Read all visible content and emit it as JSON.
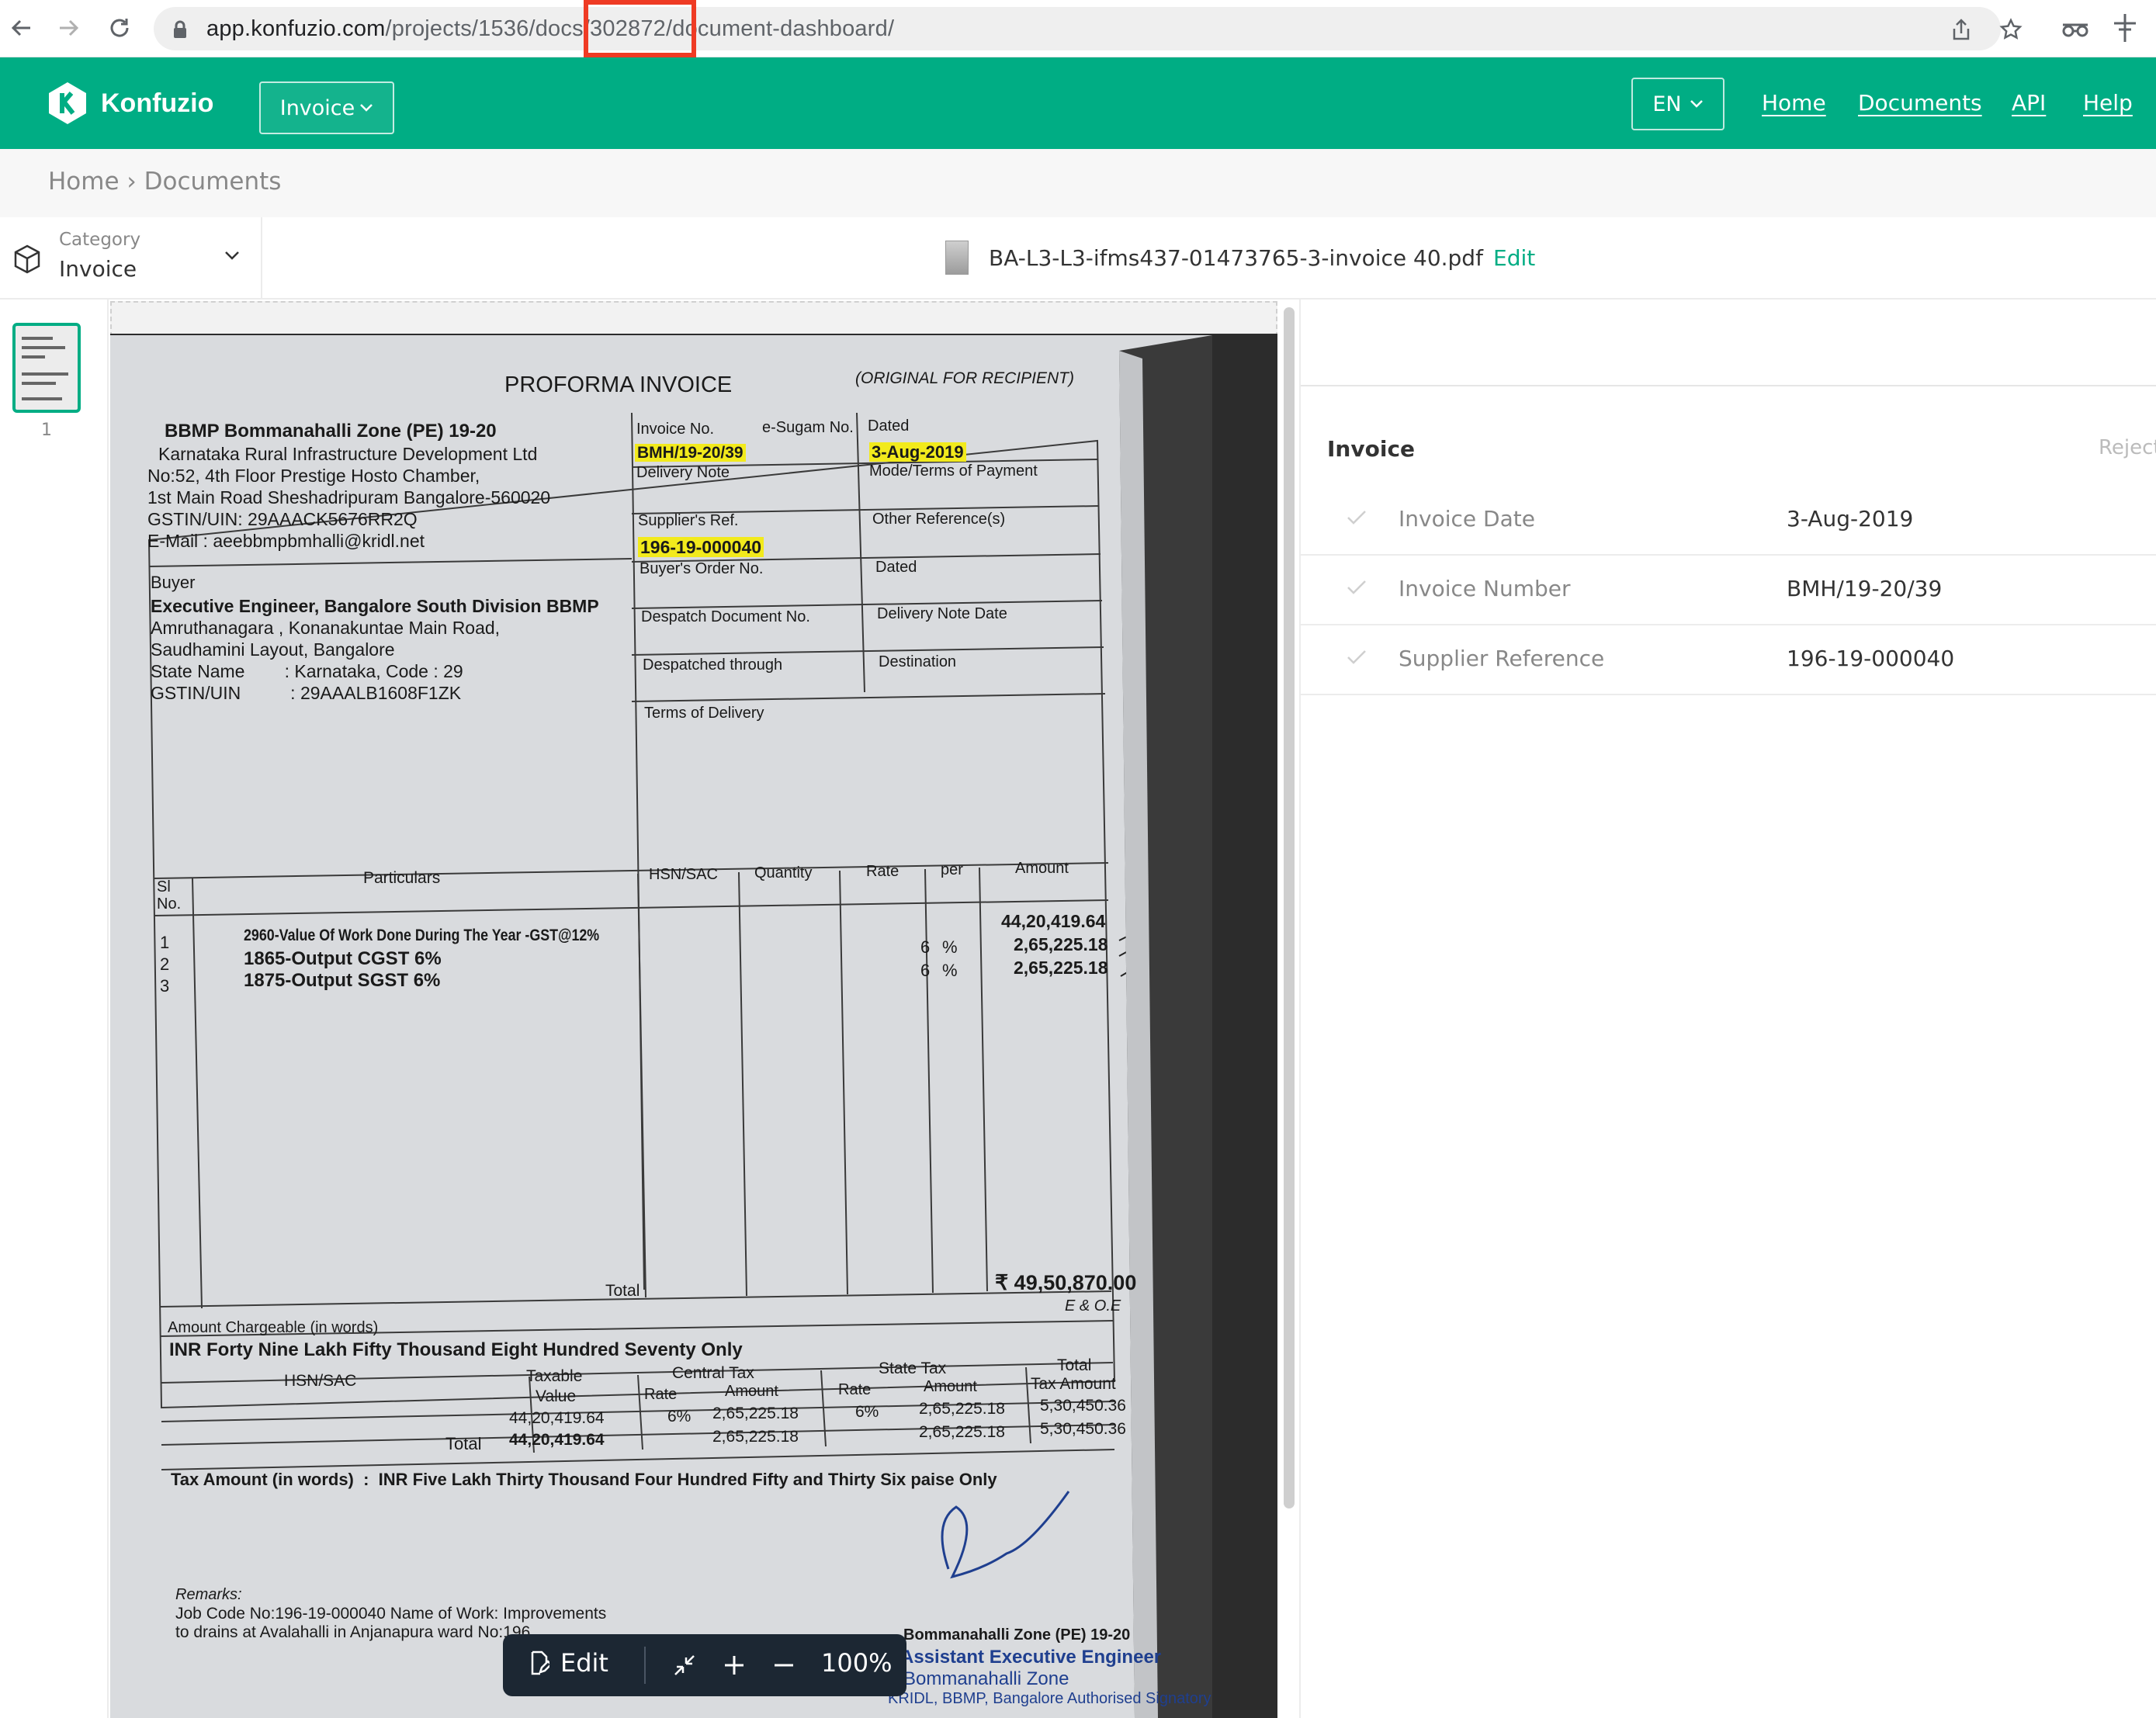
{
  "browser": {
    "url_host": "app.konfuzio.com",
    "url_path": "/projects/1536/docs/302872/document-dashboard/"
  },
  "header": {
    "logo_text": "Konfuzio",
    "doc_type_button": "Invoice",
    "language": "EN",
    "nav": [
      "Home",
      "Documents",
      "API",
      "Help"
    ]
  },
  "breadcrumb": {
    "home": "Home",
    "separator": "›",
    "current": "Documents"
  },
  "toolbar": {
    "category_label": "Category",
    "category_value": "Invoice",
    "file_name": "BA-L3-L3-ifms437-01473765-3-invoice 40.pdf",
    "edit_label": "Edit"
  },
  "pages": {
    "thumb_number": "1"
  },
  "viewer_controls": {
    "edit_label": "Edit",
    "zoom": "100%"
  },
  "invoice_doc": {
    "title": "PROFORMA INVOICE",
    "copy_note": "(ORIGINAL FOR RECIPIENT)",
    "seller": [
      "BBMP Bommanahalli Zone (PE) 19-20",
      "Karnataka Rural Infrastructure Development Ltd",
      "No:52, 4th Floor Prestige Hosto Chamber,",
      "1st Main Road Sheshadripuram Bangalore-560020",
      "GSTIN/UIN: 29AAACK5676RR2Q",
      "E-Mail : aeebbmpbmhalli@kridl.net"
    ],
    "buyer_label": "Buyer",
    "buyer": [
      "Executive Engineer, Bangalore South Division BBMP",
      "Amruthanagara , Konanakuntae Main Road,",
      "Saudhamini Layout, Bangalore",
      "State Name        : Karnataka, Code : 29",
      "GSTIN/UIN          : 29AAALB1608F1ZK"
    ],
    "fields": {
      "invoice_no_label": "Invoice No.",
      "esugam_label": "e-Sugam No.",
      "dated_label": "Dated",
      "invoice_no": "BMH/19-20/39",
      "date": "3-Aug-2019",
      "delivery_note": "Delivery Note",
      "mode_terms": "Mode/Terms of Payment",
      "suppliers_ref_label": "Supplier's Ref.",
      "other_refs": "Other Reference(s)",
      "suppliers_ref": "196-19-000040",
      "buyers_order": "Buyer's Order No.",
      "dated2": "Dated",
      "despatch_doc": "Despatch Document No.",
      "delivery_note_date": "Delivery Note Date",
      "despatched_through": "Despatched through",
      "destination": "Destination",
      "terms_of_delivery": "Terms of Delivery"
    },
    "table_headers": [
      "Sl No.",
      "Particulars",
      "HSN/SAC",
      "Quantity",
      "Rate",
      "per",
      "Amount"
    ],
    "items": [
      {
        "sl": "1",
        "particulars": "2960-Value Of Work Done During The Year -GST@12%",
        "rate": "",
        "per": "",
        "amount": "44,20,419.64"
      },
      {
        "sl": "2",
        "particulars": "1865-Output CGST 6%",
        "rate": "6",
        "per": "%",
        "amount": "2,65,225.18"
      },
      {
        "sl": "3",
        "particulars": "1875-Output SGST 6%",
        "rate": "6",
        "per": "%",
        "amount": "2,65,225.18"
      }
    ],
    "total_label": "Total",
    "total_amount": "₹ 49,50,870.00",
    "eoe": "E & O.E",
    "amount_words_label": "Amount Chargeable (in words)",
    "amount_words": "INR Forty Nine Lakh Fifty Thousand Eight Hundred Seventy Only",
    "tax_headers": {
      "hsn": "HSN/SAC",
      "taxable": "Taxable",
      "value": "Value",
      "central_tax": "Central Tax",
      "state_tax": "State Tax",
      "total": "Total",
      "tax_amount": "Tax Amount",
      "rate": "Rate",
      "amount": "Amount"
    },
    "tax_row": {
      "taxable": "44,20,419.64",
      "c_rate": "6%",
      "c_amount": "2,65,225.18",
      "s_rate": "6%",
      "s_amount": "2,65,225.18",
      "total": "5,30,450.36"
    },
    "tax_total_row": {
      "label": "Total",
      "taxable": "44,20,419.64",
      "c_amount": "2,65,225.18",
      "s_amount": "2,65,225.18",
      "total": "5,30,450.36"
    },
    "tax_words": "Tax Amount (in words)  :  INR Five Lakh Thirty Thousand Four Hundred Fifty and Thirty Six paise Only",
    "remarks_label": "Remarks:",
    "remarks": [
      "Job Code No:196-19-000040 Name of Work: Improvements",
      "to drains at Avalahalli in Anjanapura ward No:196"
    ],
    "sign_block": [
      "Bommanahalli Zone (PE) 19-20",
      "Assistant Executive Engineer",
      "Bommanahalli Zone",
      "KRIDL, BBMP, Bangalore    Authorised Signatory"
    ]
  },
  "right_panel": {
    "section_title": "Invoice",
    "reject_label": "Reject",
    "fields": [
      {
        "label": "Invoice Date",
        "value": "3-Aug-2019"
      },
      {
        "label": "Invoice Number",
        "value": "BMH/19-20/39"
      },
      {
        "label": "Supplier Reference",
        "value": "196-19-000040"
      }
    ]
  },
  "colors": {
    "brand": "#00ad84",
    "annotation": "#ef3b24",
    "highlight": "#f2ea1c"
  }
}
